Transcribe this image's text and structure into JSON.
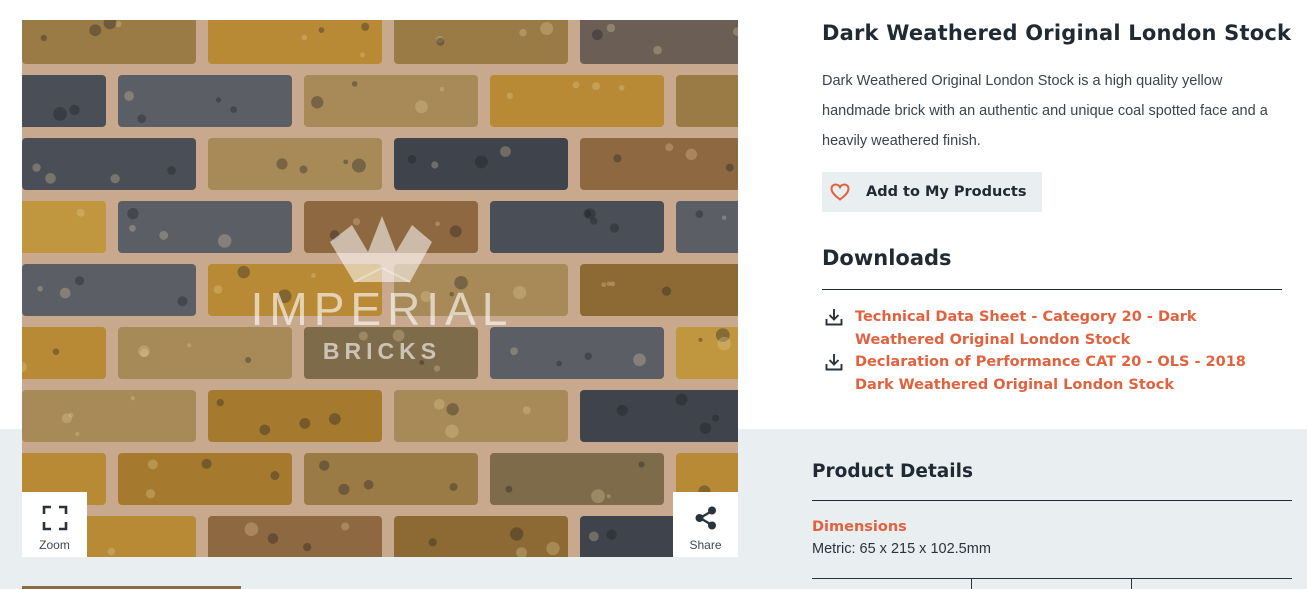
{
  "product": {
    "title": "Dark Weathered Original London Stock",
    "description": "Dark Weathered Original London Stock is a high quality yellow handmade brick with an authentic and unique coal spotted face and a heavily weathered finish.",
    "add_button_label": "Add to My Products",
    "add_button_icon": "heart-icon"
  },
  "image": {
    "watermark_brand": "IMPERIAL",
    "watermark_sub": "BRICKS",
    "zoom_label": "Zoom",
    "share_label": "Share",
    "mortar_color": "#c9a98d"
  },
  "downloads": {
    "title": "Downloads",
    "items": [
      {
        "label": "Technical Data Sheet - Category 20 - Dark Weathered Original London Stock",
        "icon": "download-icon"
      },
      {
        "label": "Declaration of Performance CAT 20 - OLS - 2018 Dark Weathered Original London Stock",
        "icon": "download-icon"
      }
    ]
  },
  "product_details": {
    "title": "Product Details",
    "dimensions_label": "Dimensions",
    "dimensions_value": "Metric: 65 x 215 x 102.5mm"
  },
  "colors": {
    "accent": "#e0623f",
    "text": "#1f2a33",
    "panel": "#e9eef0"
  }
}
